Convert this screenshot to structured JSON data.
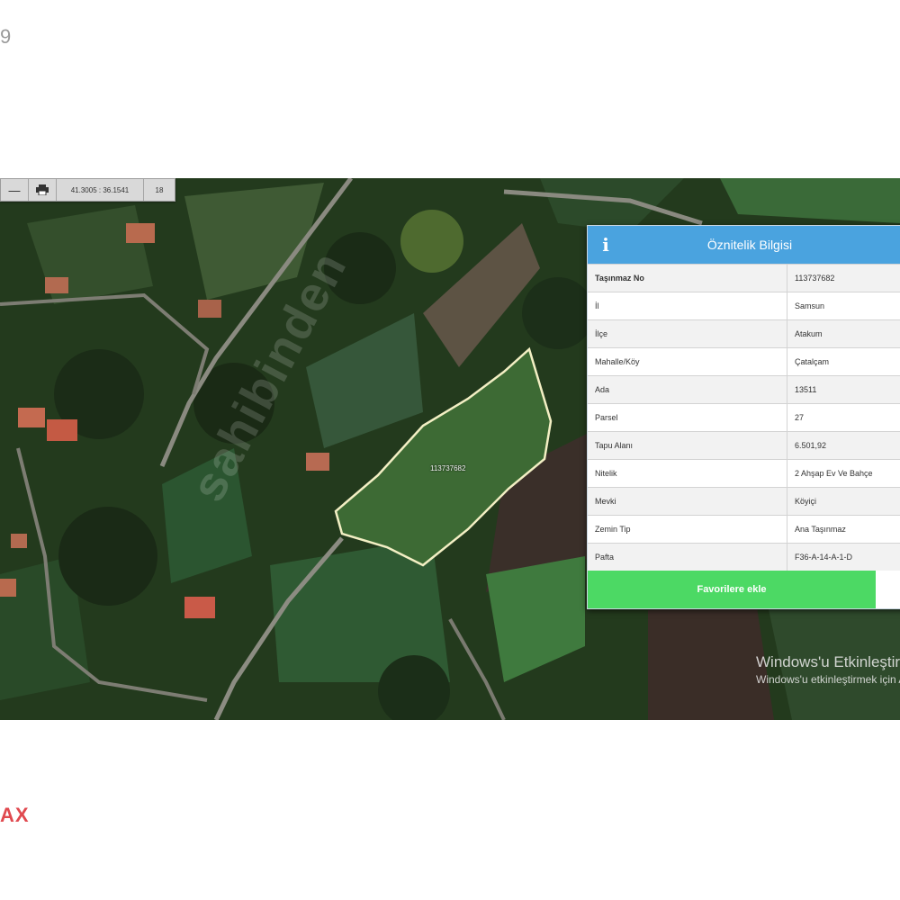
{
  "page": {
    "corner_top_left": "9",
    "corner_bottom_left": "AX"
  },
  "toolbar": {
    "minus_icon": "minus-icon",
    "print_icon": "print-icon",
    "coordinates": "41.3005 : 36.1541",
    "zoom": "18"
  },
  "map": {
    "parcel_label": "113737682",
    "watermark": "sahibinden",
    "colors": {
      "parcel_outline": "#f3efc4",
      "panel_header": "#4aa3df",
      "favorite_button": "#4cd964"
    }
  },
  "info_panel": {
    "icon": "info-icon",
    "title": "Öznitelik Bilgisi",
    "rows": [
      {
        "key": "Taşınmaz No",
        "value": "113737682"
      },
      {
        "key": "İl",
        "value": "Samsun"
      },
      {
        "key": "İlçe",
        "value": "Atakum"
      },
      {
        "key": "Mahalle/Köy",
        "value": "Çatalçam"
      },
      {
        "key": "Ada",
        "value": "13511"
      },
      {
        "key": "Parsel",
        "value": "27"
      },
      {
        "key": "Tapu Alanı",
        "value": "6.501,92"
      },
      {
        "key": "Nitelik",
        "value": "2 Ahşap Ev Ve Bahçe"
      },
      {
        "key": "Mevki",
        "value": "Köyiçi"
      },
      {
        "key": "Zemin Tip",
        "value": "Ana Taşınmaz"
      },
      {
        "key": "Pafta",
        "value": "F36-A-14-A-1-D"
      }
    ],
    "favorite_button": "Favorilere ekle"
  },
  "windows_activation": {
    "title": "Windows'u Etkinleştir",
    "subtitle": "Windows'u etkinleştirmek için Ayarlar'a gidin."
  }
}
